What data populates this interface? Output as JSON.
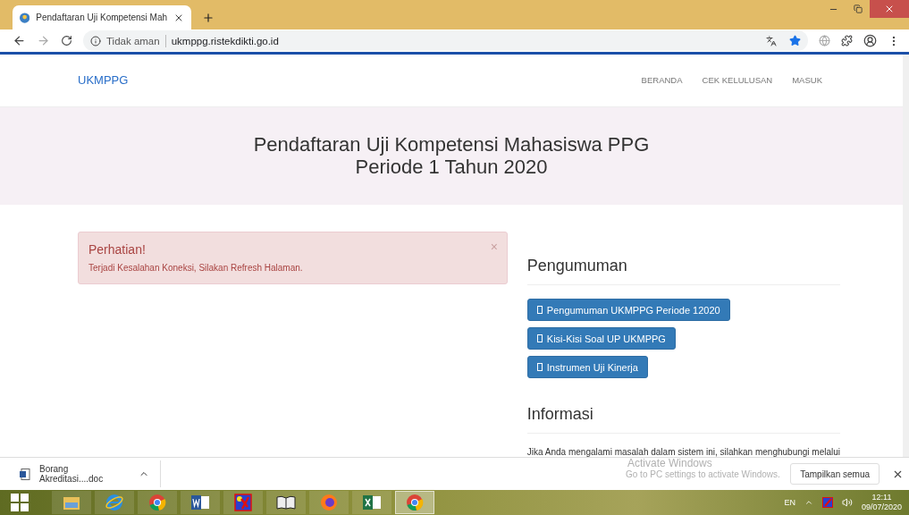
{
  "browser": {
    "tab_title": "Pendaftaran Uji Kompetensi Mah",
    "security": "Tidak aman",
    "url": "ukmppg.ristekdikti.go.id",
    "bookmarked": true
  },
  "navbar": {
    "brand": "UKMPPG",
    "links": [
      "BERANDA",
      "CEK KELULUSAN",
      "MASUK"
    ]
  },
  "hero": {
    "title": "Pendaftaran Uji Kompetensi Mahasiswa PPG",
    "subtitle": "Periode 1 Tahun 2020"
  },
  "alert": {
    "title": "Perhatian!",
    "message": "Terjadi Kesalahan Koneksi, Silakan Refresh Halaman.",
    "close": "×"
  },
  "announcements": {
    "heading": "Pengumuman",
    "buttons": [
      "Pengumuman UKMPPG Periode 12020",
      "Kisi-Kisi Soal UP UKMPPG",
      "Instrumen Uji Kinerja"
    ]
  },
  "info": {
    "heading": "Informasi",
    "text": "Jika Anda mengalami masalah dalam sistem ini, silahkan menghubungi melalui"
  },
  "download_bar": {
    "file": "Borang Akreditasi....doc",
    "show_all": "Tampilkan semua"
  },
  "os_notice": {
    "title": "Activate Windows",
    "message": "Go to PC settings to activate Windows."
  },
  "taskbar": {
    "apps": [
      {
        "kind": "files",
        "active": false
      },
      {
        "kind": "ie",
        "active": false
      },
      {
        "kind": "chrome",
        "active": false
      },
      {
        "kind": "word",
        "active": false
      },
      {
        "kind": "paint",
        "active": false
      },
      {
        "kind": "book",
        "active": false
      },
      {
        "kind": "firefox",
        "active": false
      },
      {
        "kind": "excel",
        "active": false
      },
      {
        "kind": "chrome",
        "active": true
      }
    ],
    "language": "EN",
    "time": "12:11",
    "date": "09/07/2020"
  }
}
